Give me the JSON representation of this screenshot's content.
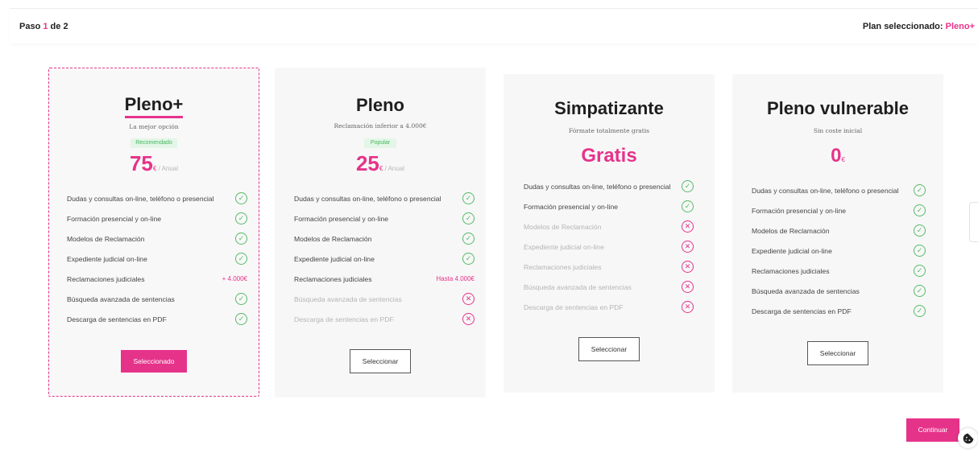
{
  "header": {
    "step_prefix": "Paso",
    "step_current": "1",
    "step_suffix": "de 2",
    "selected_label": "Plan seleccionado:",
    "selected_plan": "Pleno+"
  },
  "plans": [
    {
      "title": "Pleno+",
      "subtitle": "La mejor opción",
      "badge": "Recomendado",
      "price": "75",
      "price_unit": "€",
      "price_period": " / Anual",
      "features": [
        {
          "label": "Dudas y consultas on-line, teléfono o presencial",
          "included": true,
          "value": ""
        },
        {
          "label": "Formación presencial y on-line",
          "included": true,
          "value": ""
        },
        {
          "label": "Modelos de Reclamación",
          "included": true,
          "value": ""
        },
        {
          "label": "Expediente judicial on-line",
          "included": true,
          "value": ""
        },
        {
          "label": "Reclamaciones judiciales",
          "included": true,
          "value": "+ 4.000€"
        },
        {
          "label": "Búsqueda avanzada de sentencias",
          "included": true,
          "value": ""
        },
        {
          "label": "Descarga de sentencias en PDF",
          "included": true,
          "value": ""
        }
      ],
      "button": "Seleccionado"
    },
    {
      "title": "Pleno",
      "subtitle": "Reclamación inferior a 4.000€",
      "badge": "Popular",
      "price": "25",
      "price_unit": "€",
      "price_period": " / Anual",
      "features": [
        {
          "label": "Dudas y consultas on-line, teléfono o presencial",
          "included": true,
          "value": ""
        },
        {
          "label": "Formación presencial y on-line",
          "included": true,
          "value": ""
        },
        {
          "label": "Modelos de Reclamación",
          "included": true,
          "value": ""
        },
        {
          "label": "Expediente judicial on-line",
          "included": true,
          "value": ""
        },
        {
          "label": "Reclamaciones judiciales",
          "included": true,
          "value": "Hasta 4.000€"
        },
        {
          "label": "Búsqueda avanzada de sentencias",
          "included": false,
          "value": ""
        },
        {
          "label": "Descarga de sentencias en PDF",
          "included": false,
          "value": ""
        }
      ],
      "button": "Seleccionar"
    },
    {
      "title": "Simpatizante",
      "subtitle": "Fórmate totalmente gratis",
      "price_text": "Gratis",
      "features": [
        {
          "label": "Dudas y consultas on-line, teléfono o presencial",
          "included": true,
          "value": ""
        },
        {
          "label": "Formación presencial y on-line",
          "included": true,
          "value": ""
        },
        {
          "label": "Modelos de Reclamación",
          "included": false,
          "value": ""
        },
        {
          "label": "Expediente judicial on-line",
          "included": false,
          "value": ""
        },
        {
          "label": "Reclamaciones judiciales",
          "included": false,
          "value": ""
        },
        {
          "label": "Búsqueda avanzada de sentencias",
          "included": false,
          "value": ""
        },
        {
          "label": "Descarga de sentencias en PDF",
          "included": false,
          "value": ""
        }
      ],
      "button": "Seleccionar"
    },
    {
      "title": "Pleno vulnerable",
      "subtitle": "Sin coste inicial",
      "price": "0",
      "price_unit": "€",
      "features": [
        {
          "label": "Dudas y consultas on-line, teléfono o presencial",
          "included": true,
          "value": ""
        },
        {
          "label": "Formación presencial y on-line",
          "included": true,
          "value": ""
        },
        {
          "label": "Modelos de Reclamación",
          "included": true,
          "value": ""
        },
        {
          "label": "Expediente judicial on-line",
          "included": true,
          "value": ""
        },
        {
          "label": "Reclamaciones judiciales",
          "included": true,
          "value": ""
        },
        {
          "label": "Búsqueda avanzada de sentencias",
          "included": true,
          "value": ""
        },
        {
          "label": "Descarga de sentencias en PDF",
          "included": true,
          "value": ""
        }
      ],
      "button": "Seleccionar"
    }
  ],
  "footer": {
    "continue_label": "Continuar"
  },
  "icons": {
    "included": "check-circle-icon",
    "excluded": "x-circle-icon",
    "cookie": "cookie-icon"
  },
  "colors": {
    "accent": "#e6338a",
    "check": "#55bb66",
    "badge_bg": "#e3f6e7",
    "card_bg": "#f7f7f7"
  }
}
